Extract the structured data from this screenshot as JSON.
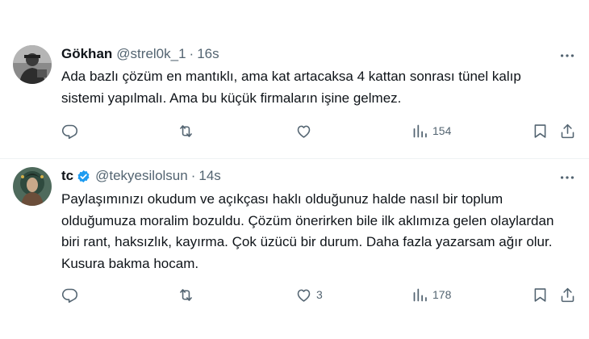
{
  "colors": {
    "text": "#0f1419",
    "secondary": "#536471",
    "verified": "#1d9bf0",
    "divider": "#eff3f4"
  },
  "tweets": [
    {
      "name": "Gökhan",
      "handle": "@strel0k_1",
      "separator": "·",
      "time": "16s",
      "verified": false,
      "text": "Ada bazlı çözüm en mantıklı, ama kat artacaksa 4 kattan sonrası tünel kalıp sistemi yapılmalı. Ama bu küçük firmaların işine gelmez.",
      "replies": "",
      "retweets": "",
      "likes": "",
      "views": "154"
    },
    {
      "name": "tc",
      "handle": "@tekyesilolsun",
      "separator": "·",
      "time": "14s",
      "verified": true,
      "text": "Paylaşımınızı okudum ve açıkçası haklı olduğunuz halde nasıl bir toplum olduğumuza moralim bozuldu. Çözüm önerirken bile ilk aklımıza gelen olaylardan biri rant, haksızlık, kayırma. Çok üzücü bir durum. Daha fazla yazarsam ağır olur.  Kusura bakma hocam.",
      "replies": "",
      "retweets": "",
      "likes": "3",
      "views": "178"
    }
  ],
  "icons": {
    "reply": "reply-icon",
    "retweet": "retweet-icon",
    "like": "heart-icon",
    "views": "views-chart-icon",
    "bookmark": "bookmark-icon",
    "share": "share-icon",
    "more": "more-dots-icon"
  }
}
